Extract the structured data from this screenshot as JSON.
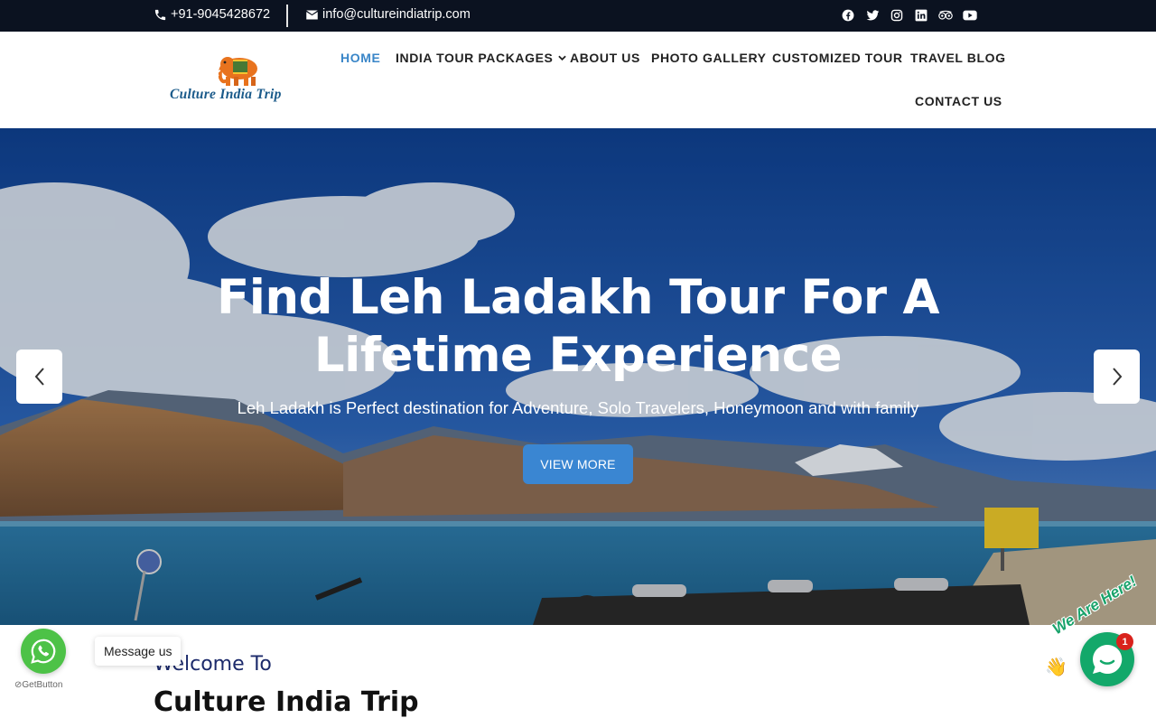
{
  "topbar": {
    "phone": "+91-9045428672",
    "email": "info@cultureindiatrip.com",
    "social_icons": [
      "facebook-icon",
      "twitter-icon",
      "instagram-icon",
      "linkedin-icon",
      "tripadvisor-icon",
      "youtube-icon"
    ]
  },
  "header": {
    "logo_text": "Culture India Trip",
    "nav": {
      "home": "HOME",
      "packages": "INDIA TOUR PACKAGES",
      "about": "ABOUT US",
      "gallery": "PHOTO GALLERY",
      "customized": "CUSTOMIZED TOUR",
      "blog": "TRAVEL BLOG",
      "contact": "CONTACT US"
    }
  },
  "hero": {
    "title_line1": "Find Leh Ladakh Tour For A",
    "title_line2": "Lifetime Experience",
    "subtitle": "Leh Ladakh is Perfect destination for Adventure, Solo Travelers, Honeymoon and with family",
    "button": "VIEW MORE"
  },
  "intro": {
    "welcome": "Welcome To",
    "brand": "Culture India Trip"
  },
  "widgets": {
    "whatsapp_tooltip": "Message us",
    "getbutton": "GetButton",
    "we_are_here": "We Are Here!",
    "chat_badge": "1"
  },
  "colors": {
    "topbar_bg": "#0b1220",
    "accent": "#3a86d2",
    "nav_active": "#3a86c8",
    "whatsapp": "#4dc247",
    "chat": "#13a86a"
  }
}
